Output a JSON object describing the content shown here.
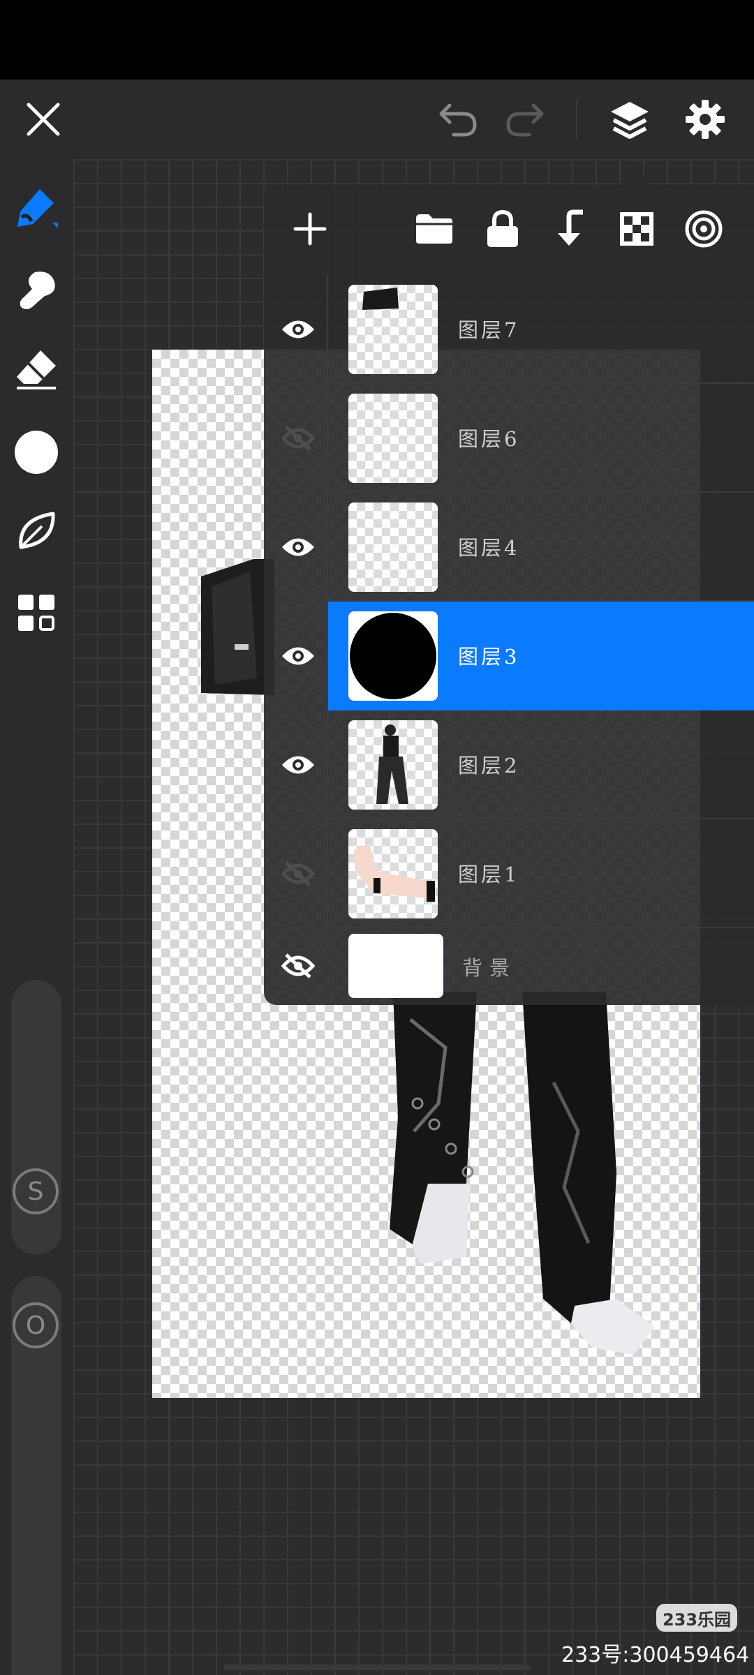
{
  "colors": {
    "accent": "#0a7aff",
    "toolbar_bg": "#2b2b2d",
    "panel_bg": "#2b2b2e",
    "icon": "#ffffff",
    "icon_disabled": "#6d6d70"
  },
  "topbar": {
    "icons": [
      "close-icon",
      "undo-icon",
      "redo-icon",
      "layers-icon",
      "settings-icon"
    ]
  },
  "tools": [
    "brush-icon",
    "smudge-icon",
    "eraser-icon",
    "color-picker",
    "leaf-icon",
    "grid-icon"
  ],
  "sliders": {
    "size_label": "S",
    "opacity_label": "O"
  },
  "layers_panel": {
    "toolbar_icons": [
      "add-layer-icon",
      "folder-icon",
      "lock-icon",
      "merge-down-icon",
      "alpha-lock-icon",
      "layer-blend-icon"
    ],
    "layers": [
      {
        "name": "图层7",
        "visible": true,
        "selected": false
      },
      {
        "name": "图层6",
        "visible": false,
        "selected": false
      },
      {
        "name": "图层4",
        "visible": true,
        "selected": false
      },
      {
        "name": "图层3",
        "visible": true,
        "selected": true
      },
      {
        "name": "图层2",
        "visible": true,
        "selected": false
      },
      {
        "name": "图层1",
        "visible": false,
        "selected": false
      },
      {
        "name": "背景",
        "visible": false,
        "selected": false
      }
    ]
  },
  "watermark": {
    "logo": "233乐园",
    "text": "233号:300459464"
  }
}
